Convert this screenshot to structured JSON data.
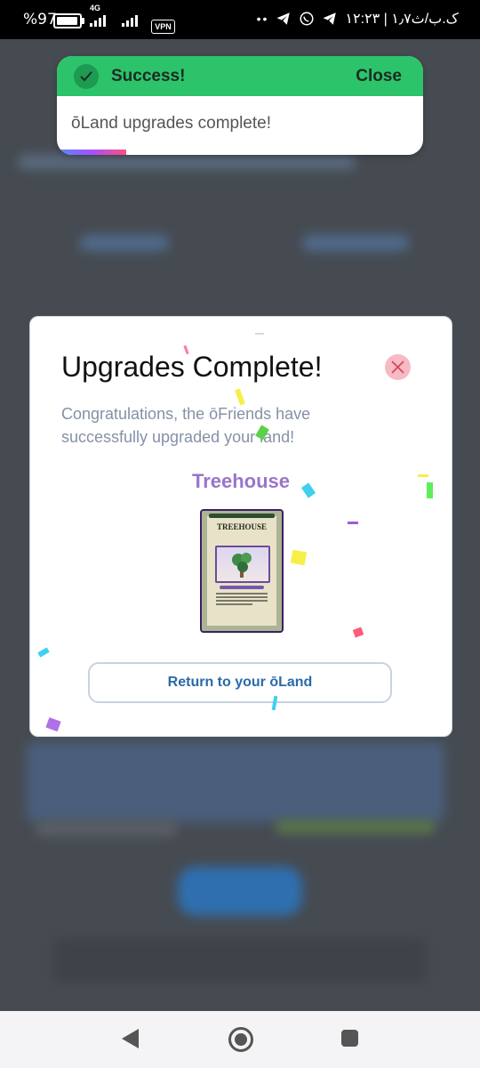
{
  "status_bar": {
    "battery_percent": "%97",
    "battery_level": 0.97,
    "network": "4G",
    "vpn": "VPN",
    "time": "۱۲:۲۳ | ۱٫۷ک.ب/ث",
    "dots": "••"
  },
  "toast": {
    "title": "Success!",
    "close_label": "Close",
    "message": "ōLand upgrades complete!",
    "accent": "#2cc36b"
  },
  "modal": {
    "title": "Upgrades Complete!",
    "subtitle": "Congratulations, the ōFriends have successfully upgraded your land!",
    "land_name": "Treehouse",
    "card_name": "TREEHOUSE",
    "button_label": "Return to your ōLand"
  },
  "colors": {
    "accent_green": "#2cc36b",
    "land_purple": "#9a74c9",
    "button_text": "#2a6aa8",
    "close_bg": "#f7b9c4"
  },
  "icons": {
    "toast": "check-circle-icon",
    "modal_close": "close-icon",
    "nav": [
      "back-icon",
      "home-icon",
      "recents-icon"
    ]
  }
}
